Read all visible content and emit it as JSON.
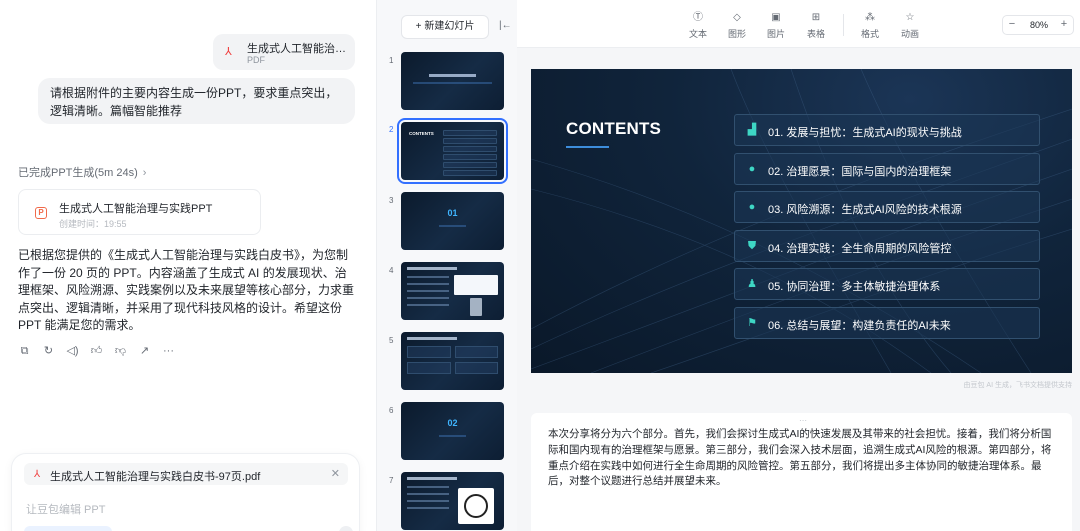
{
  "chat": {
    "attachment": {
      "name": "生成式人工智能治理...",
      "type": "PDF"
    },
    "user_message": "请根据附件的主要内容生成一份PPT，要求重点突出，逻辑清晰。篇幅智能推荐",
    "status": "已完成PPT生成(5m 24s)",
    "ppt_card": {
      "title": "生成式人工智能治理与实践PPT",
      "time": "创建时间：19:55"
    },
    "reply": "已根据您提供的《生成式人工智能治理与实践白皮书》，为您制作了一份 20 页的 PPT。内容涵盖了生成式 AI 的发展现状、治理框架、风险溯源、实践案例以及未来展望等核心部分，力求重点突出、逻辑清晰，并采用了现代科技风格的设计。希望这份 PPT 能满足您的需求。",
    "actions": [
      "copy-icon",
      "refresh-icon",
      "speaker-icon",
      "thumb-up-icon",
      "thumb-down-icon",
      "share-icon",
      "more-icon"
    ],
    "composer": {
      "attachment": "生成式人工智能治理与实践白皮书-97页.pdf",
      "placeholder": "让豆包编辑 PPT"
    }
  },
  "thumbs": {
    "new_slide": "新建幻灯片",
    "items": [
      {
        "num": "1"
      },
      {
        "num": "2",
        "contents": "CONTENTS"
      },
      {
        "num": "3",
        "big": "01"
      },
      {
        "num": "4"
      },
      {
        "num": "5"
      },
      {
        "num": "6",
        "big": "02"
      },
      {
        "num": "7"
      }
    ],
    "selected": "2"
  },
  "toolbar": {
    "tools": [
      {
        "label": "文本",
        "icon": "text-icon"
      },
      {
        "label": "图形",
        "icon": "shape-icon"
      },
      {
        "label": "图片",
        "icon": "image-icon"
      },
      {
        "label": "表格",
        "icon": "table-icon"
      },
      {
        "label": "格式",
        "icon": "format-icon"
      },
      {
        "label": "动画",
        "icon": "animation-icon"
      }
    ],
    "zoom": "80%"
  },
  "slide": {
    "heading": "CONTENTS",
    "items": [
      {
        "text": "01. 发展与担忧：生成式AI的现状与挑战",
        "icon": "chart-icon"
      },
      {
        "text": "02. 治理愿景：国际与国内的治理框架",
        "icon": "bulb-icon"
      },
      {
        "text": "03. 风险溯源：生成式AI风险的技术根源",
        "icon": "circle-icon"
      },
      {
        "text": "04. 治理实践：全生命周期的风险管控",
        "icon": "shield-icon"
      },
      {
        "text": "05. 协同治理：多主体敏捷治理体系",
        "icon": "people-icon"
      },
      {
        "text": "06. 总结与展望：构建负责任的AI未来",
        "icon": "flag-icon"
      }
    ],
    "accent": "#3ed6c4",
    "background": "#10243b"
  },
  "watermark": "由豆包 AI 生成，飞书文档提供支持",
  "notes": "本次分享将分为六个部分。首先，我们会探讨生成式AI的快速发展及其带来的社会担忧。接着，我们将分析国际和国内现有的治理框架与愿景。第三部分，我们会深入技术层面，追溯生成式AI风险的根源。第四部分，将重点介绍在实践中如何进行全生命周期的风险管控。第五部分，我们将提出多主体协同的敏捷治理体系。最后，对整个议题进行总结并展望未来。"
}
